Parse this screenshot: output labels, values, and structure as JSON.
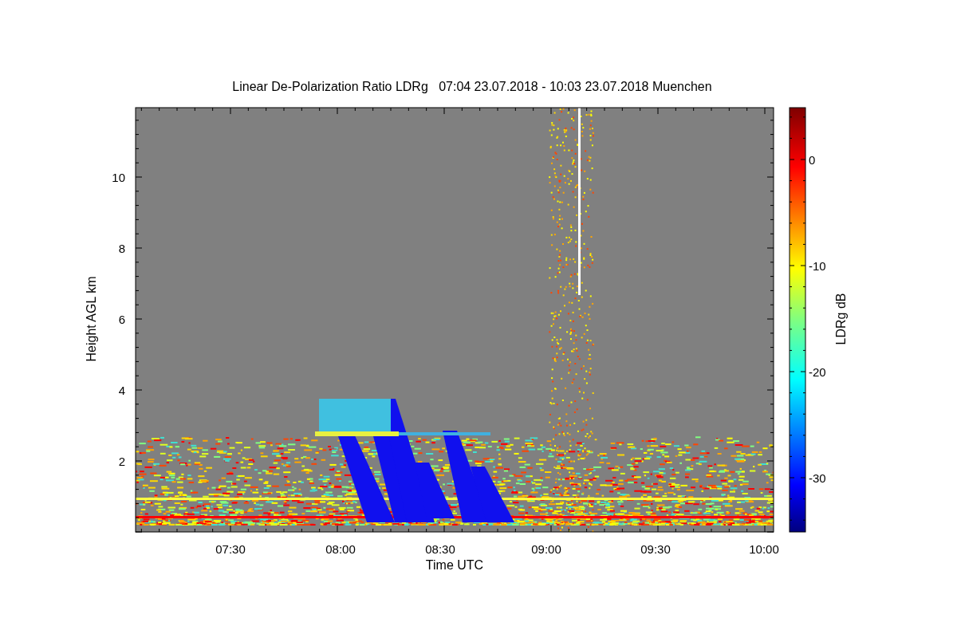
{
  "title": "Linear De-Polarization Ratio LDRg   07:04 23.07.2018 - 10:03 23.07.2018 Muenchen",
  "y_axis": {
    "label": "Height AGL km",
    "ticks": [
      "10",
      "8",
      "6",
      "4",
      "2"
    ]
  },
  "x_axis": {
    "label": "Time UTC",
    "ticks": [
      "07:30",
      "08:00",
      "08:30",
      "09:00",
      "09:30",
      "10:00"
    ]
  },
  "colorbar": {
    "label": "LDRg dB",
    "ticks": [
      "0",
      "-10",
      "-20",
      "-30"
    ]
  }
}
